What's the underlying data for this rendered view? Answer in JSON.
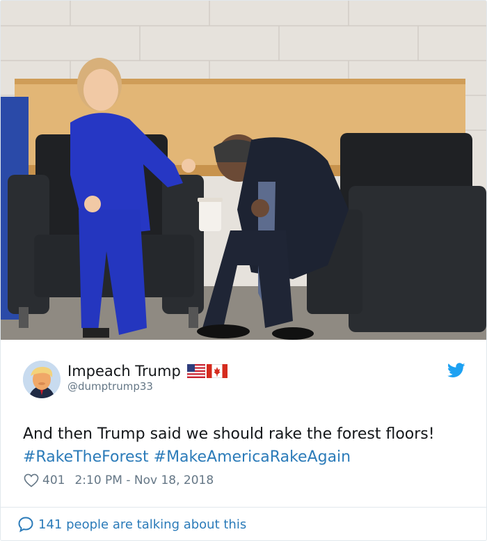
{
  "tweet": {
    "display_name": "Impeach Trump",
    "handle": "@dumptrump33",
    "flags": [
      "us-flag-icon",
      "canada-flag-icon"
    ],
    "text": {
      "plain": "And then Trump said we should rake the forest floors!",
      "hashtags": [
        "#RakeTheForest",
        "#MakeAmericaRakeAgain"
      ]
    },
    "likes": "401",
    "timestamp": "2:10 PM - Nov 18, 2018",
    "conversation_label": "141 people are talking about this"
  },
  "colors": {
    "link_blue": "#2b7bb9",
    "twitter_blue": "#1da1f2",
    "meta_gray": "#657786",
    "text": "#14171a",
    "border": "#e1e8ed"
  },
  "icons": {
    "brand": "twitter-bird-icon",
    "like": "heart-outline-icon",
    "conversation": "speech-bubble-icon"
  }
}
